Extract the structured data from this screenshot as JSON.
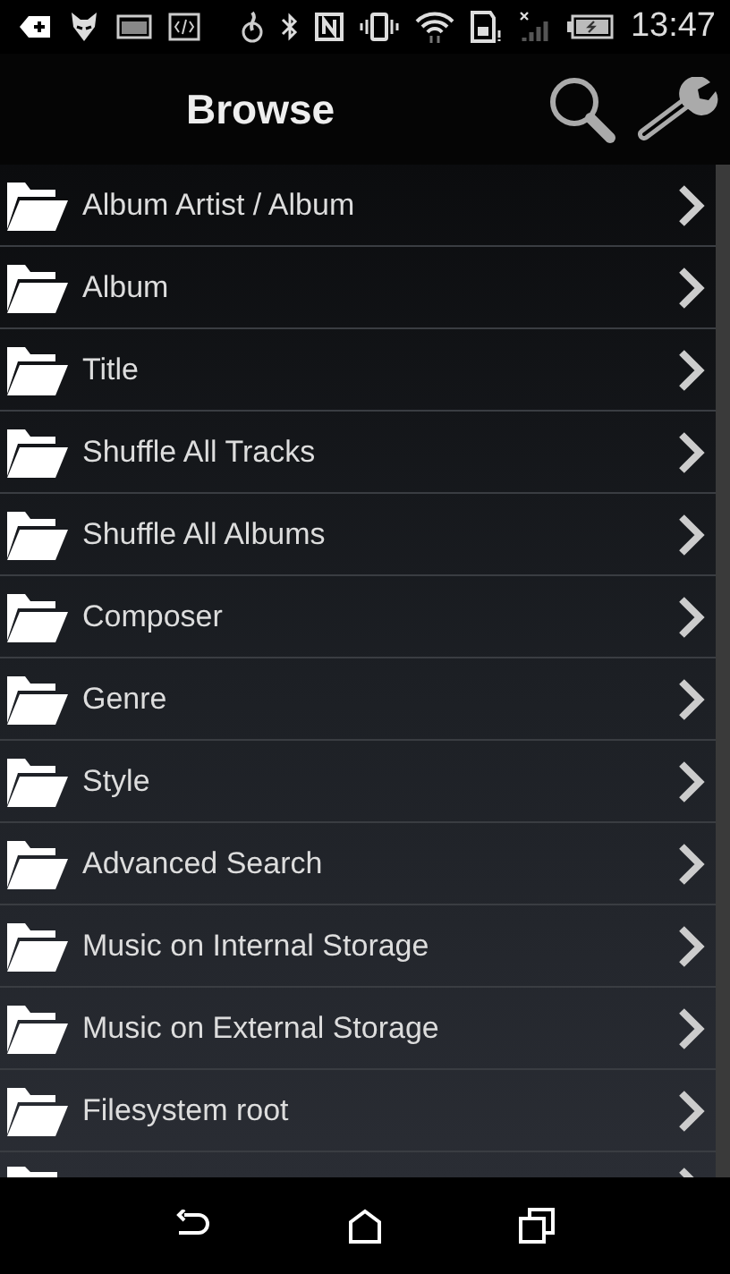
{
  "status_bar": {
    "time": "13:47"
  },
  "header": {
    "title": "Browse"
  },
  "items": [
    {
      "label": "Album Artist / Album"
    },
    {
      "label": "Album"
    },
    {
      "label": "Title"
    },
    {
      "label": "Shuffle All Tracks"
    },
    {
      "label": "Shuffle All Albums"
    },
    {
      "label": "Composer"
    },
    {
      "label": "Genre"
    },
    {
      "label": "Style"
    },
    {
      "label": "Advanced Search"
    },
    {
      "label": "Music on Internal Storage"
    },
    {
      "label": "Music on External Storage"
    },
    {
      "label": "Filesystem root"
    }
  ],
  "more_below": true
}
